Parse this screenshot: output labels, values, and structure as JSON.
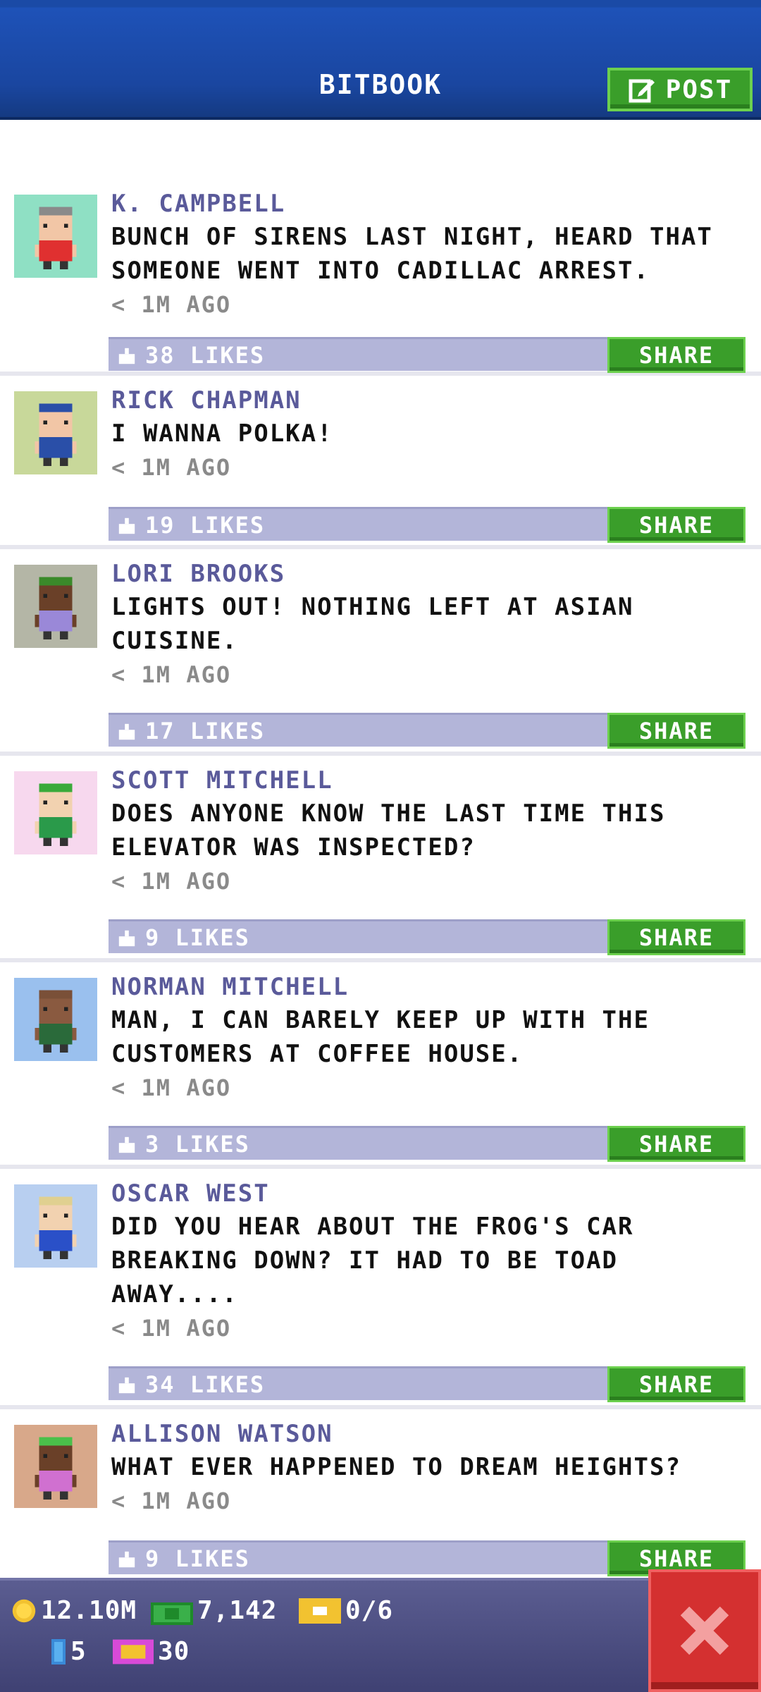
{
  "header": {
    "title": "BITBOOK",
    "post_label": "POST"
  },
  "posts": [
    {
      "author": "K. CAMPBELL",
      "message": "BUNCH OF SIRENS LAST NIGHT, HEARD THAT SOMEONE WENT INTO CADILLAC ARREST.",
      "time": "< 1M AGO",
      "likes": "38 LIKES",
      "share": "SHARE",
      "avatar_bg": "#8fe0c4",
      "shirt": "#e03030",
      "hair": "#8a8a8a",
      "skin": "#f2c6a6"
    },
    {
      "author": "RICK CHAPMAN",
      "message": "I WANNA POLKA!",
      "time": "< 1M AGO",
      "likes": "19 LIKES",
      "share": "SHARE",
      "avatar_bg": "#c8d89a",
      "shirt": "#2a4fa8",
      "hair": "#2a4fa8",
      "skin": "#f2c6a6"
    },
    {
      "author": "LORI BROOKS",
      "message": "LIGHTS OUT! NOTHING LEFT AT ASIAN CUISINE.",
      "time": "< 1M AGO",
      "likes": "17 LIKES",
      "share": "SHARE",
      "avatar_bg": "#b4b6a6",
      "shirt": "#9a88d8",
      "hair": "#3a8a2a",
      "skin": "#6a4028"
    },
    {
      "author": "SCOTT MITCHELL",
      "message": "DOES ANYONE KNOW THE LAST TIME THIS ELEVATOR WAS INSPECTED?",
      "time": "< 1M AGO",
      "likes": "9 LIKES",
      "share": "SHARE",
      "avatar_bg": "#f7d8ee",
      "shirt": "#2a9a4a",
      "hair": "#3aaa3a",
      "skin": "#f2d2b0"
    },
    {
      "author": "NORMAN MITCHELL",
      "message": "MAN, I CAN BARELY KEEP UP WITH THE CUSTOMERS AT COFFEE HOUSE.",
      "time": "< 1M AGO",
      "likes": "3 LIKES",
      "share": "SHARE",
      "avatar_bg": "#9ac0ee",
      "shirt": "#2a6a3a",
      "hair": "#7a5038",
      "skin": "#8a5a40"
    },
    {
      "author": "OSCAR WEST",
      "message": "DID YOU HEAR ABOUT THE FROG'S CAR BREAKING DOWN? IT HAD TO BE TOAD AWAY....",
      "time": "< 1M AGO",
      "likes": "34 LIKES",
      "share": "SHARE",
      "avatar_bg": "#b8cff0",
      "shirt": "#2a50c8",
      "hair": "#e0d090",
      "skin": "#f2d2b0"
    },
    {
      "author": "ALLISON WATSON",
      "message": "WHAT EVER HAPPENED TO DREAM HEIGHTS?",
      "time": "< 1M AGO",
      "likes": "9 LIKES",
      "share": "SHARE",
      "avatar_bg": "#d8a88a",
      "shirt": "#d070d0",
      "hair": "#4ac04a",
      "skin": "#6a4028"
    }
  ],
  "footer": {
    "coins": "12.10M",
    "bux": "7,142",
    "tickets": "0/6",
    "keys": "5",
    "gems": "30"
  },
  "colors": {
    "accent_green": "#3a9e2a",
    "header_blue": "#1a46a0",
    "likes_bar": "#b3b5d9",
    "close_red": "#d43030"
  }
}
